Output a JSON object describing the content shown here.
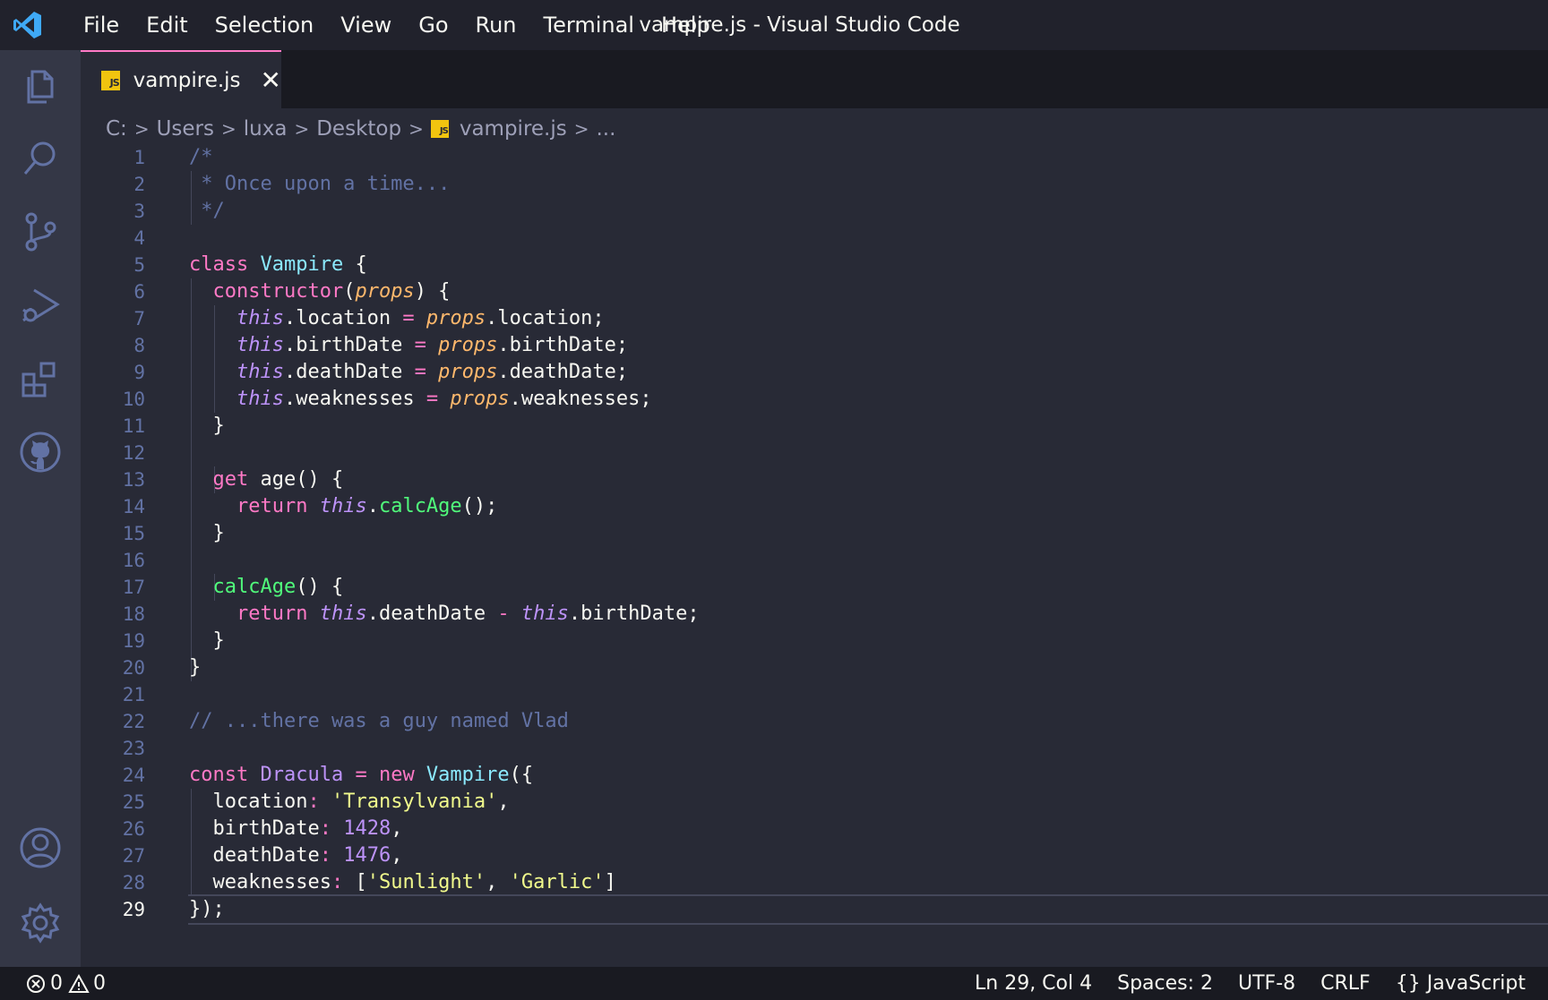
{
  "window": {
    "title": "vampire.js - Visual Studio Code"
  },
  "menu": [
    "File",
    "Edit",
    "Selection",
    "View",
    "Go",
    "Run",
    "Terminal",
    "Help"
  ],
  "activity_icons": [
    "files-icon",
    "search-icon",
    "source-control-icon",
    "run-debug-icon",
    "extensions-icon",
    "github-icon",
    "account-icon",
    "settings-gear-icon"
  ],
  "tab": {
    "label": "vampire.js",
    "close": "✕",
    "badge": "JS"
  },
  "breadcrumb": {
    "drive": "C:",
    "users": "Users",
    "user": "luxa",
    "folder": "Desktop",
    "file": "vampire.js",
    "more": "..."
  },
  "editor": {
    "active_line": 29,
    "line_numbers": [
      "1",
      "2",
      "3",
      "4",
      "5",
      "6",
      "7",
      "8",
      "9",
      "10",
      "11",
      "12",
      "13",
      "14",
      "15",
      "16",
      "17",
      "18",
      "19",
      "20",
      "21",
      "22",
      "23",
      "24",
      "25",
      "26",
      "27",
      "28",
      "29"
    ]
  },
  "code": {
    "l1": "/*",
    "l2": " * Once upon a time...",
    "l3": " */",
    "l5_kw": "class",
    "l5_name": "Vampire",
    "l5_brace": " {",
    "l6_ctor": "constructor",
    "l6_open": "(",
    "l6_param": "props",
    "l6_close": ") {",
    "l7_this": "this",
    "l7_prop": ".location ",
    "l7_eq": "=",
    "l7_param": " props",
    "l7_rest": ".location;",
    "l8_this": "this",
    "l8_prop": ".birthDate ",
    "l8_eq": "=",
    "l8_param": " props",
    "l8_rest": ".birthDate;",
    "l9_this": "this",
    "l9_prop": ".deathDate ",
    "l9_eq": "=",
    "l9_param": " props",
    "l9_rest": ".deathDate;",
    "l10_this": "this",
    "l10_prop": ".weaknesses ",
    "l10_eq": "=",
    "l10_param": " props",
    "l10_rest": ".weaknesses;",
    "l11": "}",
    "l13_kw": "get",
    "l13_rest": " age() {",
    "l14_kw": "return",
    "l14_this": " this",
    "l14_dot": ".",
    "l14_fn": "calcAge",
    "l14_rest": "();",
    "l15": "}",
    "l17_fn": "calcAge",
    "l17_rest": "() {",
    "l18_kw": "return",
    "l18_this": " this",
    "l18_mid": ".deathDate ",
    "l18_op": "-",
    "l18_this2": " this",
    "l18_rest": ".birthDate;",
    "l19": "}",
    "l20": "}",
    "l22": "// ...there was a guy named Vlad",
    "l24_kw": "const",
    "l24_var": " Dracula",
    "l24_eq": " =",
    "l24_new": " new",
    "l24_cls": " Vampire",
    "l24_rest": "({",
    "l25_key": "location",
    "l25_colon": ":",
    "l25_val": " 'Transylvania'",
    "l25_rest": ",",
    "l26_key": "birthDate",
    "l26_colon": ":",
    "l26_val": " 1428",
    "l26_rest": ",",
    "l27_key": "deathDate",
    "l27_colon": ":",
    "l27_val": " 1476",
    "l27_rest": ",",
    "l28_key": "weaknesses",
    "l28_colon": ":",
    "l28_open": " [",
    "l28_v1": "'Sunlight'",
    "l28_comma": ", ",
    "l28_v2": "'Garlic'",
    "l28_close": "]",
    "l29": "});"
  },
  "status": {
    "errors": "0",
    "warnings": "0",
    "position": "Ln 29, Col 4",
    "spaces": "Spaces: 2",
    "encoding": "UTF-8",
    "eol": "CRLF",
    "language": "JavaScript"
  },
  "colors": {
    "background": "#282a36",
    "keyword": "#ff79c6",
    "class": "#8be9fd",
    "function": "#50fa7b",
    "this": "#bd93f9",
    "param": "#ffb86c",
    "string": "#f1fa8c",
    "comment": "#6272a4"
  }
}
